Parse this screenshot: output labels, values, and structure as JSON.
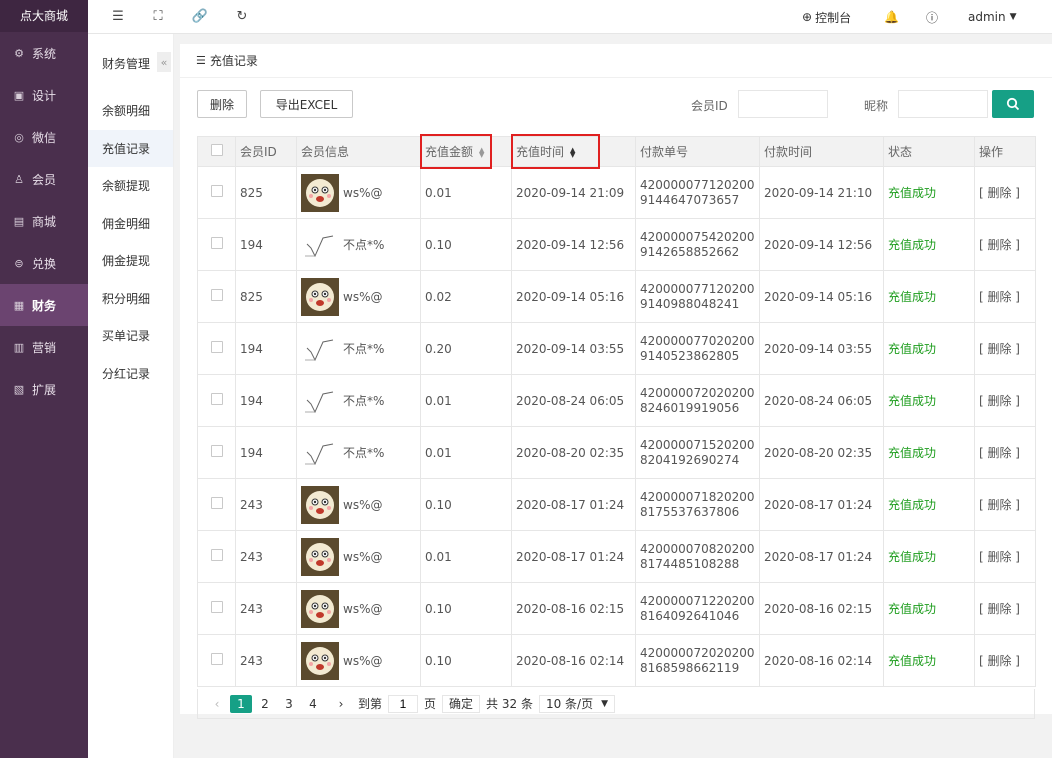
{
  "app": {
    "logo": "点大商城"
  },
  "left_nav": [
    {
      "label": "系统",
      "icon": "gear-icon"
    },
    {
      "label": "设计",
      "icon": "design-icon"
    },
    {
      "label": "微信",
      "icon": "wechat-icon"
    },
    {
      "label": "会员",
      "icon": "user-icon"
    },
    {
      "label": "商城",
      "icon": "mall-icon"
    },
    {
      "label": "兑换",
      "icon": "exchange-icon"
    },
    {
      "label": "财务",
      "icon": "finance-icon",
      "active": true
    },
    {
      "label": "营销",
      "icon": "marketing-icon"
    },
    {
      "label": "扩展",
      "icon": "extend-icon"
    }
  ],
  "topbar": {
    "console": "控制台",
    "user": "admin"
  },
  "subnav": {
    "title": "财务管理",
    "items": [
      "余额明细",
      "充值记录",
      "余额提现",
      "佣金明细",
      "佣金提现",
      "积分明细",
      "买单记录",
      "分红记录"
    ]
  },
  "card": {
    "title": "充值记录"
  },
  "toolbar": {
    "delete_label": "删除",
    "export_label": "导出EXCEL",
    "member_id_label": "会员ID",
    "nickname_label": "昵称"
  },
  "table": {
    "headers": [
      "会员ID",
      "会员信息",
      "充值金额",
      "充值时间",
      "付款单号",
      "付款时间",
      "状态",
      "操作"
    ],
    "rows": [
      {
        "id": "825",
        "nick": "ws%@",
        "avatar": "cartoon",
        "amount": "0.01",
        "time": "2020-09-14 21:09",
        "payno": "4200000771202009144647073657",
        "paytime": "2020-09-14 21:10",
        "status": "充值成功",
        "op": "[ 删除 ]"
      },
      {
        "id": "194",
        "nick": "不点*%",
        "avatar": "sketch",
        "amount": "0.10",
        "time": "2020-09-14 12:56",
        "payno": "4200000754202009142658852662",
        "paytime": "2020-09-14 12:56",
        "status": "充值成功",
        "op": "[ 删除 ]"
      },
      {
        "id": "825",
        "nick": "ws%@",
        "avatar": "cartoon",
        "amount": "0.02",
        "time": "2020-09-14 05:16",
        "payno": "4200000771202009140988048241",
        "paytime": "2020-09-14 05:16",
        "status": "充值成功",
        "op": "[ 删除 ]"
      },
      {
        "id": "194",
        "nick": "不点*%",
        "avatar": "sketch",
        "amount": "0.20",
        "time": "2020-09-14 03:55",
        "payno": "4200000770202009140523862805",
        "paytime": "2020-09-14 03:55",
        "status": "充值成功",
        "op": "[ 删除 ]"
      },
      {
        "id": "194",
        "nick": "不点*%",
        "avatar": "sketch",
        "amount": "0.01",
        "time": "2020-08-24 06:05",
        "payno": "4200000720202008246019919056",
        "paytime": "2020-08-24 06:05",
        "status": "充值成功",
        "op": "[ 删除 ]"
      },
      {
        "id": "194",
        "nick": "不点*%",
        "avatar": "sketch",
        "amount": "0.01",
        "time": "2020-08-20 02:35",
        "payno": "4200000715202008204192690274",
        "paytime": "2020-08-20 02:35",
        "status": "充值成功",
        "op": "[ 删除 ]"
      },
      {
        "id": "243",
        "nick": "ws%@",
        "avatar": "cartoon",
        "amount": "0.10",
        "time": "2020-08-17 01:24",
        "payno": "4200000718202008175537637806",
        "paytime": "2020-08-17 01:24",
        "status": "充值成功",
        "op": "[ 删除 ]"
      },
      {
        "id": "243",
        "nick": "ws%@",
        "avatar": "cartoon",
        "amount": "0.01",
        "time": "2020-08-17 01:24",
        "payno": "4200000708202008174485108288",
        "paytime": "2020-08-17 01:24",
        "status": "充值成功",
        "op": "[ 删除 ]"
      },
      {
        "id": "243",
        "nick": "ws%@",
        "avatar": "cartoon",
        "amount": "0.10",
        "time": "2020-08-16 02:15",
        "payno": "4200000712202008164092641046",
        "paytime": "2020-08-16 02:15",
        "status": "充值成功",
        "op": "[ 删除 ]"
      },
      {
        "id": "243",
        "nick": "ws%@",
        "avatar": "cartoon",
        "amount": "0.10",
        "time": "2020-08-16 02:14",
        "payno": "4200000720202008168598662119",
        "paytime": "2020-08-16 02:14",
        "status": "充值成功",
        "op": "[ 删除 ]"
      }
    ]
  },
  "pager": {
    "pages": [
      "1",
      "2",
      "3",
      "4"
    ],
    "current": "1",
    "goto_label": "到第",
    "goto_value": "1",
    "page_unit": "页",
    "confirm": "确定",
    "total": "共 32 条",
    "per_page": "10 条/页"
  },
  "colors": {
    "sidebar": "#4a2f4d",
    "accent": "#16a086",
    "status": "#1e9d1e",
    "highlight": "#e02020"
  }
}
